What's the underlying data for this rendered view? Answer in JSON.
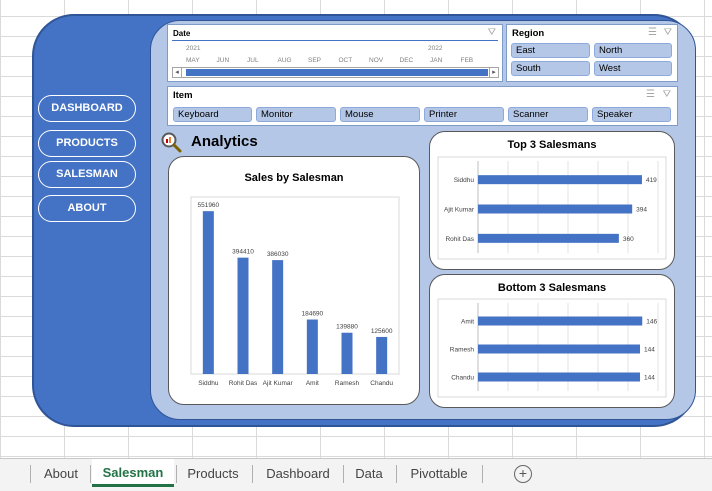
{
  "nav": {
    "dashboard": "DASHBOARD",
    "products": "PRODUCTS",
    "salesman": "SALESMAN",
    "about": "ABOUT"
  },
  "date_slicer": {
    "title": "Date",
    "years": [
      "2021",
      "2022"
    ],
    "months": [
      "MAY",
      "JUN",
      "JUL",
      "AUG",
      "SEP",
      "OCT",
      "NOV",
      "DEC",
      "JAN",
      "FEB"
    ]
  },
  "region_slicer": {
    "title": "Region",
    "items": [
      "East",
      "North",
      "South",
      "West"
    ]
  },
  "item_slicer": {
    "title": "Item",
    "items": [
      "Keyboard",
      "Monitor",
      "Mouse",
      "Printer",
      "Scanner",
      "Speaker"
    ]
  },
  "analytics_title": "Analytics",
  "chart_data": [
    {
      "type": "bar",
      "title": "Sales by Salesman",
      "categories": [
        "Siddhu",
        "Rohit Das",
        "Ajit Kumar",
        "Amit",
        "Ramesh",
        "Chandu"
      ],
      "values": [
        551960,
        394410,
        386030,
        184690,
        139880,
        125600
      ],
      "ylim": [
        0,
        600000
      ],
      "color": "#4472c4"
    },
    {
      "type": "bar",
      "orientation": "horizontal",
      "title": "Top 3 Salesmans",
      "categories": [
        "Siddhu",
        "Ajit Kumar",
        "Rohit Das"
      ],
      "values": [
        419,
        394,
        360
      ],
      "xlim": [
        0,
        460
      ],
      "color": "#4472c4"
    },
    {
      "type": "bar",
      "orientation": "horizontal",
      "title": "Bottom 3 Salesmans",
      "categories": [
        "Amit",
        "Ramesh",
        "Chandu"
      ],
      "values": [
        146,
        144,
        144
      ],
      "xlim": [
        0,
        160
      ],
      "color": "#4472c4"
    }
  ],
  "sheet_tabs": [
    "About",
    "Salesman",
    "Products",
    "Dashboard",
    "Data",
    "Pivottable"
  ],
  "active_tab": "Salesman",
  "icons": {
    "filter_clear": "filter-clear-icon",
    "multiselect": "multi-select-icon",
    "analytics": "magnifier-chart-icon",
    "add_sheet": "plus-circle-icon"
  }
}
